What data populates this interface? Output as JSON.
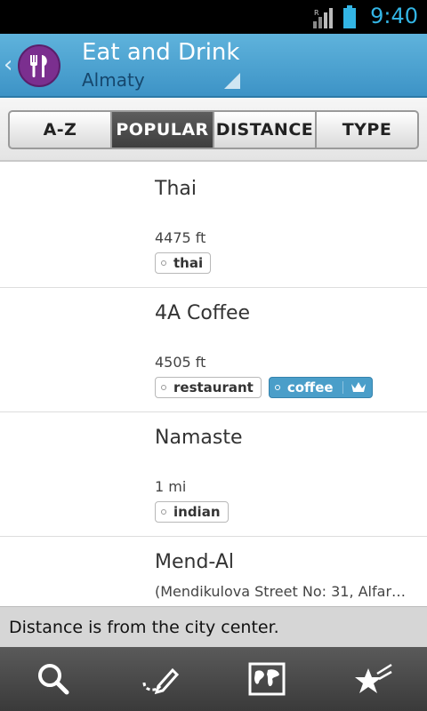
{
  "statusbar": {
    "time": "9:40",
    "icons": [
      "signal-icon",
      "battery-icon"
    ]
  },
  "header": {
    "title": "Eat and Drink",
    "subtitle": "Almaty",
    "logo_icon": "fork-knife-icon",
    "accent": "#4ea7d6",
    "logo_color": "#7b2f8f"
  },
  "tabs": [
    {
      "label": "A-Z",
      "active": false
    },
    {
      "label": "POPULAR",
      "active": true
    },
    {
      "label": "DISTANCE",
      "active": false
    },
    {
      "label": "TYPE",
      "active": false
    }
  ],
  "list": [
    {
      "name": "Thai",
      "distance": "4475 ft",
      "tags": [
        {
          "label": "thai",
          "premium": false
        }
      ]
    },
    {
      "name": "4A Coffee",
      "distance": "4505 ft",
      "tags": [
        {
          "label": "restaurant",
          "premium": false
        },
        {
          "label": "coffee",
          "premium": true
        }
      ]
    },
    {
      "name": "Namaste",
      "distance": "1 mi",
      "tags": [
        {
          "label": "indian",
          "premium": false
        }
      ]
    },
    {
      "name": "Mend-Al",
      "address": "(Mendikulova Street No: 31, Alfara..."
    }
  ],
  "notice": "Distance is from the city center.",
  "bottom_bar": [
    "search-icon",
    "edit-route-icon",
    "map-icon",
    "favorites-star-icon"
  ]
}
